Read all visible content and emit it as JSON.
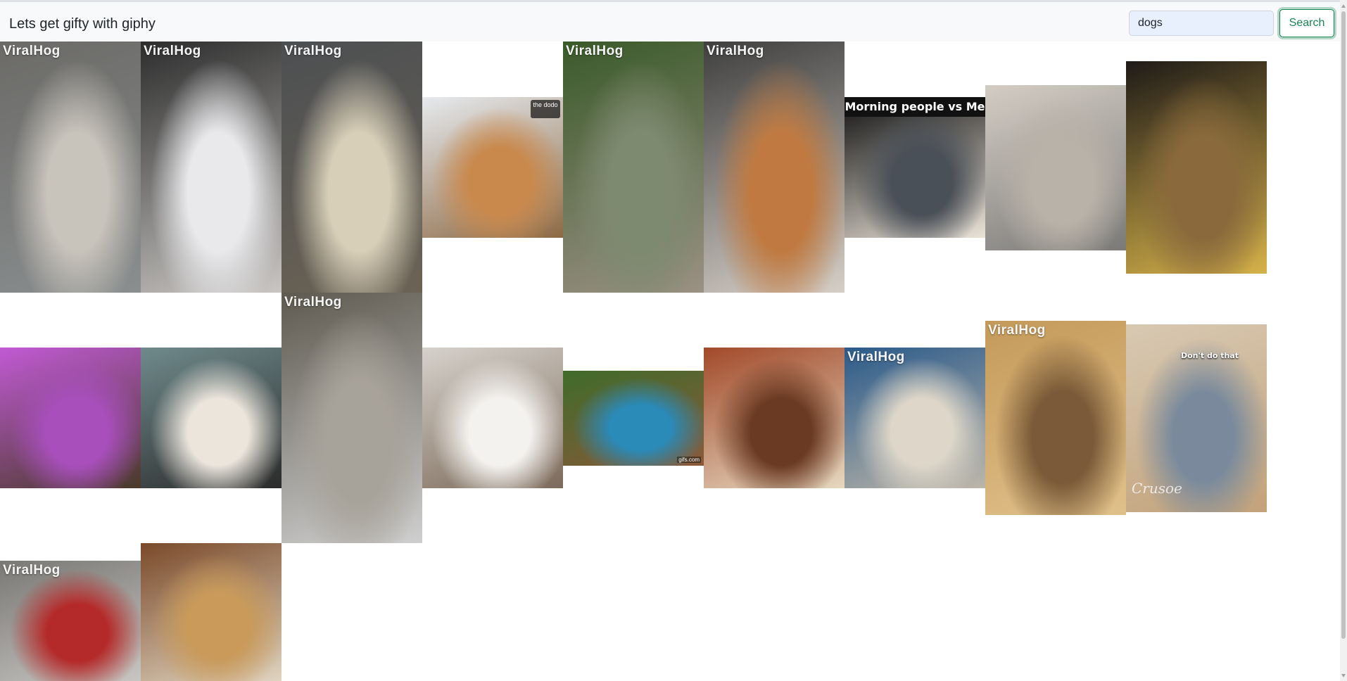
{
  "navbar": {
    "brand": "Lets get gifty with giphy",
    "search": {
      "value": "dogs",
      "placeholder": ""
    },
    "button_label": "Search"
  },
  "colors": {
    "accent": "#198754",
    "navbar_bg": "#f8f9fa",
    "input_bg": "#e8f0fe"
  },
  "results": [
    {
      "watermark": "ViralHog",
      "caption": "",
      "colors": [
        "#6b6a67",
        "#c8c3bb",
        "#8a8e8f"
      ]
    },
    {
      "watermark": "ViralHog",
      "caption": "",
      "colors": [
        "#2d2d2d",
        "#e9e9ec",
        "#c9c6c3"
      ]
    },
    {
      "watermark": "ViralHog",
      "caption": "",
      "colors": [
        "#4c4f52",
        "#d8cfb8",
        "#6b6355"
      ]
    },
    {
      "watermark": "",
      "badge": "the dodo",
      "caption": "",
      "colors": [
        "#e6eaee",
        "#c9894d",
        "#8e6a45"
      ]
    },
    {
      "watermark": "ViralHog",
      "caption": "",
      "colors": [
        "#3a5a2a",
        "#7e8a70",
        "#9b9184"
      ]
    },
    {
      "watermark": "ViralHog",
      "caption": "",
      "colors": [
        "#3f3f3f",
        "#c07a41",
        "#d6cfc7"
      ]
    },
    {
      "watermark": "",
      "caption": "Morning people vs Me",
      "colors": [
        "#111111",
        "#4a5058",
        "#eae3d8"
      ]
    },
    {
      "watermark": "",
      "caption": "",
      "colors": [
        "#d3cdc4",
        "#b9b2a8",
        "#7b7a78"
      ]
    },
    {
      "watermark": "",
      "caption": "",
      "colors": [
        "#1e1a17",
        "#8a6a3c",
        "#d6b24a"
      ]
    },
    {
      "watermark": "",
      "caption": "",
      "colors": [
        "#c15ad4",
        "#a84fbc",
        "#4a3a2a"
      ]
    },
    {
      "watermark": "",
      "caption": "",
      "colors": [
        "#6f8a8c",
        "#ebe5dc",
        "#2b2b2b"
      ]
    },
    {
      "watermark": "ViralHog",
      "caption": "",
      "colors": [
        "#5e5a50",
        "#a8a39a",
        "#cfcfcf"
      ]
    },
    {
      "watermark": "",
      "caption": "",
      "colors": [
        "#d6d2cc",
        "#f4f2ef",
        "#7c6a5a"
      ]
    },
    {
      "watermark": "",
      "caption": "",
      "tiny": "gifs.com",
      "colors": [
        "#3f6b2a",
        "#2a8ab8",
        "#8a5a3a"
      ]
    },
    {
      "watermark": "",
      "caption": "",
      "colors": [
        "#a24a2a",
        "#6b3a22",
        "#e6d8c0"
      ]
    },
    {
      "watermark": "ViralHog",
      "caption": "",
      "colors": [
        "#2a5a8a",
        "#ded7c9",
        "#bdb6a9"
      ]
    },
    {
      "watermark": "ViralHog",
      "caption": "",
      "colors": [
        "#c49a5a",
        "#7a5a38",
        "#e0c08a"
      ]
    },
    {
      "watermark": "",
      "caption": "Don't do that",
      "script": "Crusoe",
      "colors": [
        "#d8c9b3",
        "#7a8a9c",
        "#c2a27a"
      ]
    },
    {
      "watermark": "ViralHog",
      "caption": "",
      "colors": [
        "#7a7874",
        "#b42a2a",
        "#c8c6c2"
      ]
    },
    {
      "watermark": "",
      "caption": "",
      "colors": [
        "#7a4a2a",
        "#c99a5a",
        "#e0d4c0"
      ]
    }
  ]
}
